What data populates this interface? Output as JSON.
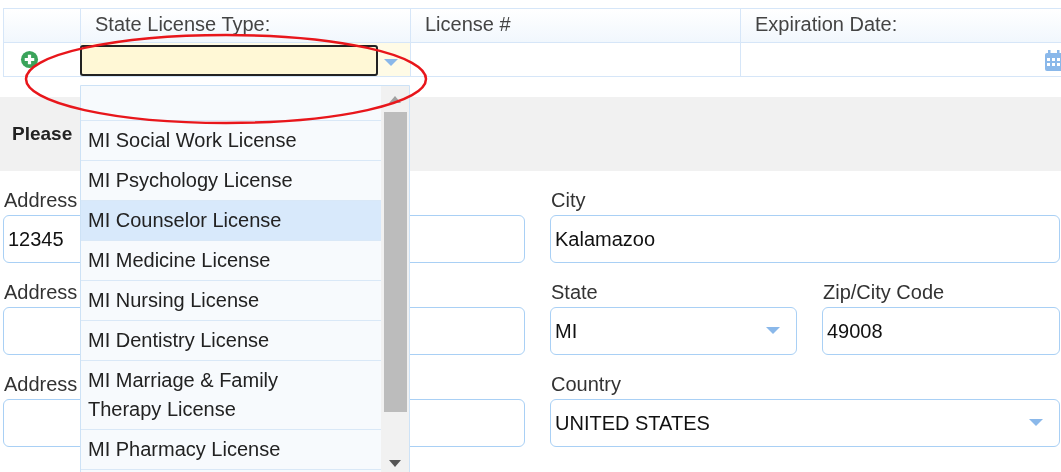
{
  "license_table": {
    "columns": [
      "State License Type:",
      "License #",
      "Expiration Date:"
    ]
  },
  "license_type_dropdown": {
    "options": [
      {
        "label": "MI Social Work License",
        "selected": false
      },
      {
        "label": "MI Psychology License",
        "selected": false
      },
      {
        "label": "MI Counselor License",
        "selected": true
      },
      {
        "label": "MI Medicine License",
        "selected": false
      },
      {
        "label": "MI Nursing License",
        "selected": false
      },
      {
        "label": "MI Dentistry License",
        "selected": false
      },
      {
        "label": "MI Marriage & Family Therapy License",
        "selected": false
      },
      {
        "label": "MI Pharmacy License",
        "selected": false
      }
    ]
  },
  "highlight_circle": true,
  "section_heading": "Please",
  "address_fields": [
    {
      "label": "Address",
      "value": "12345"
    },
    {
      "label": "Address"
    },
    {
      "label": "Address"
    }
  ],
  "location_fields": [
    {
      "kind": "text",
      "label": "City",
      "value": "Kalamazoo"
    },
    {
      "kind": "select",
      "label": "State",
      "value": "MI"
    },
    {
      "kind": "text",
      "label": "Zip/City Code",
      "value": "49008"
    },
    {
      "kind": "select",
      "label": "Country",
      "value": "UNITED STATES"
    }
  ]
}
